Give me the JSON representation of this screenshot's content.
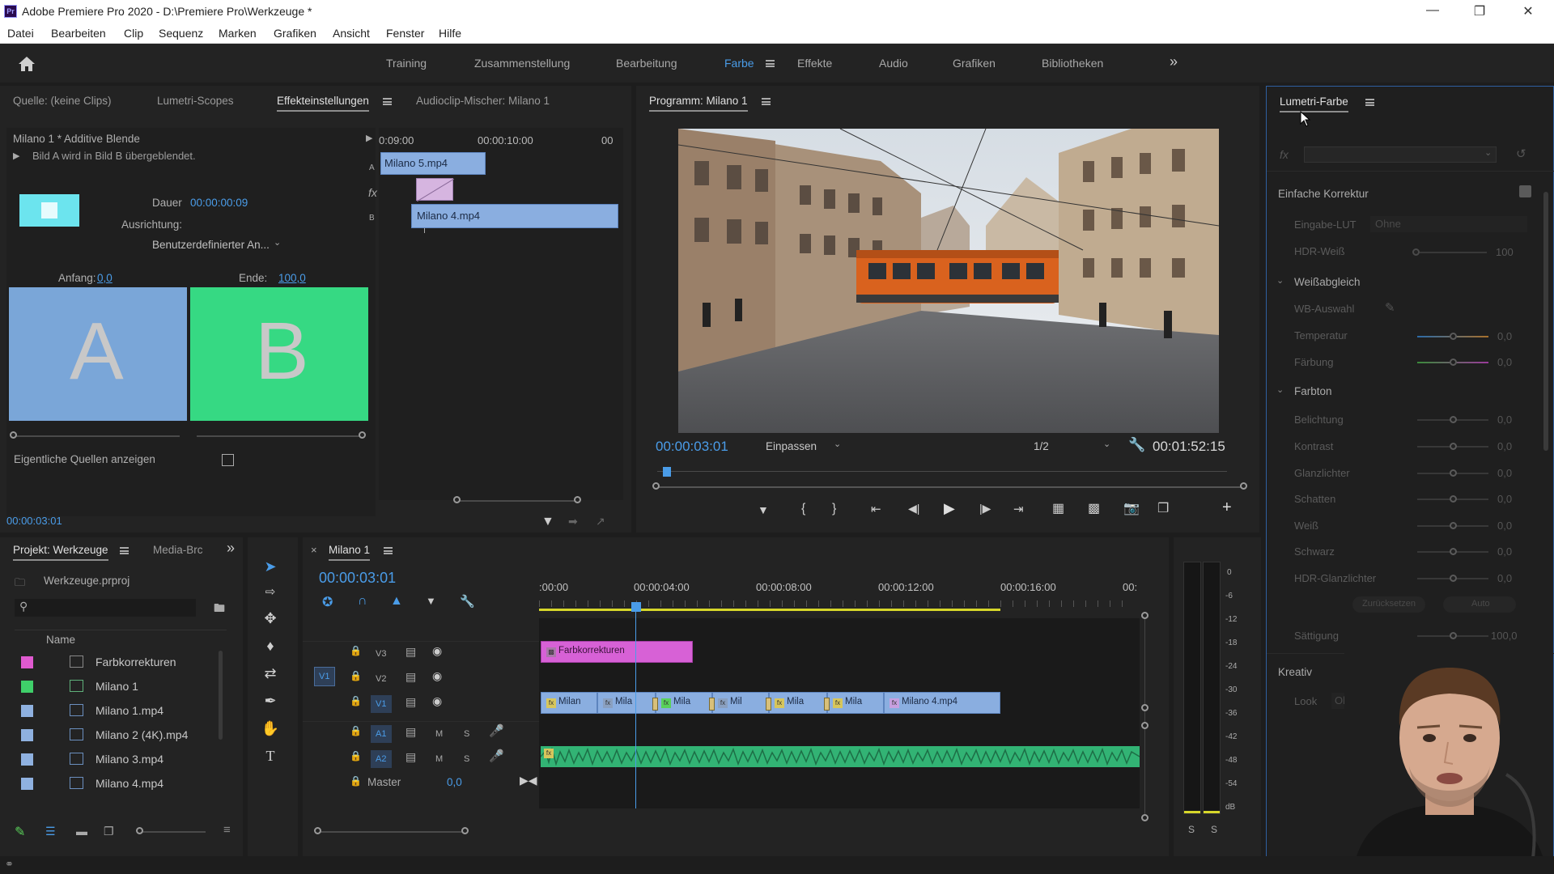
{
  "window": {
    "title": "Adobe Premiere Pro 2020 - D:\\Premiere Pro\\Werkzeuge *",
    "app_icon": "Pr"
  },
  "menu": [
    "Datei",
    "Bearbeiten",
    "Clip",
    "Sequenz",
    "Marken",
    "Grafiken",
    "Ansicht",
    "Fenster",
    "Hilfe"
  ],
  "workspaces": [
    "Training",
    "Zusammenstellung",
    "Bearbeitung",
    "Farbe",
    "Effekte",
    "Audio",
    "Grafiken",
    "Bibliotheken"
  ],
  "active_workspace": "Farbe",
  "source_panel": {
    "tabs": [
      "Quelle: (keine Clips)",
      "Lumetri-Scopes",
      "Effekteinstellungen",
      "Audioclip-Mischer: Milano 1"
    ],
    "active_tab": "Effekteinstellungen",
    "clip_header": "Milano 1 * Additive Blende",
    "description": "Bild A wird in Bild B übergeblendet.",
    "dauer_label": "Dauer",
    "dauer_value": "00:00:00:09",
    "ausrichtung_label": "Ausrichtung:",
    "ausrichtung_value": "Benutzerdefinierter An...",
    "anfang_label": "Anfang:",
    "anfang_value": "0,0",
    "ende_label": "Ende:",
    "ende_value": "100,0",
    "preview_a": "A",
    "preview_b": "B",
    "show_sources_label": "Eigentliche Quellen anzeigen",
    "timecode": "00:00:03:01",
    "mini_timeline": {
      "t0": "0:09:00",
      "t1": "00:00:10:00",
      "t2": "00",
      "track_a": "A",
      "track_b": "B",
      "clip_a": "Milano 5.mp4",
      "clip_b": "Milano 4.mp4",
      "fx": "fx"
    }
  },
  "program_monitor": {
    "title": "Programm: Milano 1",
    "timecode": "00:00:03:01",
    "fit": "Einpassen",
    "resolution": "1/2",
    "duration": "00:01:52:15"
  },
  "lumetri": {
    "title": "Lumetri-Farbe",
    "fx_label": "fx",
    "einfache_korrektur": "Einfache Korrektur",
    "eingabe_lut_label": "Eingabe-LUT",
    "eingabe_lut_value": "Ohne",
    "hdr_weiss_label": "HDR-Weiß",
    "hdr_weiss_value": "100",
    "weissabgleich": "Weißabgleich",
    "wb_auswahl": "WB-Auswahl",
    "temperatur_label": "Temperatur",
    "temperatur_value": "0,0",
    "faerbung_label": "Färbung",
    "faerbung_value": "0,0",
    "farbton": "Farbton",
    "tone_rows": [
      {
        "label": "Belichtung",
        "value": "0,0"
      },
      {
        "label": "Kontrast",
        "value": "0,0"
      },
      {
        "label": "Glanzlichter",
        "value": "0,0"
      },
      {
        "label": "Schatten",
        "value": "0,0"
      },
      {
        "label": "Weiß",
        "value": "0,0"
      },
      {
        "label": "Schwarz",
        "value": "0,0"
      },
      {
        "label": "HDR-Glanzlichter",
        "value": "0,0"
      }
    ],
    "zuruecksetzen": "Zurücksetzen",
    "auto": "Auto",
    "saettigung_label": "Sättigung",
    "saettigung_value": "100,0",
    "kreativ": "Kreativ",
    "look_label": "Look",
    "look_value": "Oh"
  },
  "project_panel": {
    "tabs": [
      "Projekt: Werkzeuge",
      "Media-Brc"
    ],
    "project_file": "Werkzeuge.prproj",
    "column_name": "Name",
    "items": [
      {
        "name": "Farbkorrekturen",
        "color": "#e05ad0"
      },
      {
        "name": "Milano 1",
        "color": "#3fcf6a"
      },
      {
        "name": "Milano 1.mp4",
        "color": "#8fb1e0"
      },
      {
        "name": "Milano 2 (4K).mp4",
        "color": "#8fb1e0"
      },
      {
        "name": "Milano 3.mp4",
        "color": "#8fb1e0"
      },
      {
        "name": "Milano 4.mp4",
        "color": "#8fb1e0"
      }
    ]
  },
  "timeline": {
    "sequence_name": "Milano 1",
    "timecode": "00:00:03:01",
    "ruler": [
      ":00:00",
      "00:00:04:00",
      "00:00:08:00",
      "00:00:12:00",
      "00:00:16:00",
      "00:"
    ],
    "tracks": {
      "v3": "V3",
      "v2": "V2",
      "v1": "V1",
      "v1_source": "V1",
      "a1": "A1",
      "a2": "A2",
      "master": "Master",
      "master_value": "0,0",
      "m": "M",
      "s": "S"
    },
    "v3_clip": "Farbkorrekturen",
    "v1_clips": [
      "Milan",
      "Mila",
      "Mila",
      "Mil",
      "Mila",
      "Mila",
      "Milano 4.mp4"
    ]
  },
  "audio_meter": {
    "scale": [
      "0",
      "-6",
      "-12",
      "-18",
      "-24",
      "-30",
      "-36",
      "-42",
      "-48",
      "-54",
      "dB"
    ],
    "solo_left": "S",
    "solo_right": "S"
  }
}
